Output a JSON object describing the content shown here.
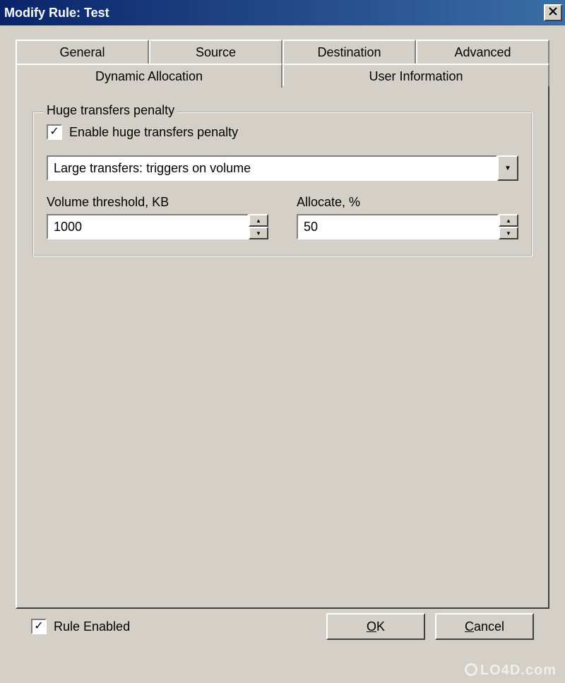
{
  "titlebar": {
    "text": "Modify Rule: Test",
    "close": "×"
  },
  "tabs": {
    "row1": [
      "General",
      "Source",
      "Destination",
      "Advanced"
    ],
    "row2": [
      "Dynamic Allocation",
      "User Information"
    ]
  },
  "fieldset": {
    "legend": "Huge transfers penalty",
    "enable_checkbox_label": "Enable huge transfers penalty",
    "select_value": "Large transfers: triggers on volume",
    "volume_label": "Volume threshold, KB",
    "volume_value": "1000",
    "allocate_label": "Allocate, %",
    "allocate_value": "50"
  },
  "footer": {
    "rule_enabled_label": "Rule Enabled",
    "ok": "OK",
    "cancel": "Cancel"
  },
  "watermark": "LO4D.com"
}
